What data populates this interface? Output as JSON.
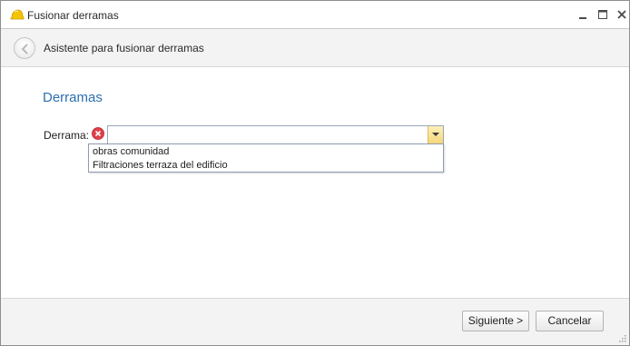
{
  "window": {
    "title": "Fusionar derramas",
    "icons": {
      "app": "hard-hat-icon",
      "minimize": "minimize-icon",
      "maximize": "maximize-icon",
      "close": "close-icon"
    }
  },
  "header": {
    "title": "Asistente para fusionar derramas",
    "back_icon": "back-arrow-icon"
  },
  "section": {
    "title": "Derramas"
  },
  "form": {
    "derrama_label": "Derrama:",
    "derrama_value": "",
    "error_icon": "error-icon",
    "options": [
      "obras comunidad",
      "Filtraciones terraza del edificio"
    ]
  },
  "footer": {
    "next_label": "Siguiente >",
    "cancel_label": "Cancelar"
  },
  "colors": {
    "accent": "#2d6fb1",
    "error": "#e0404a",
    "combo_button": "#f6d67a"
  }
}
